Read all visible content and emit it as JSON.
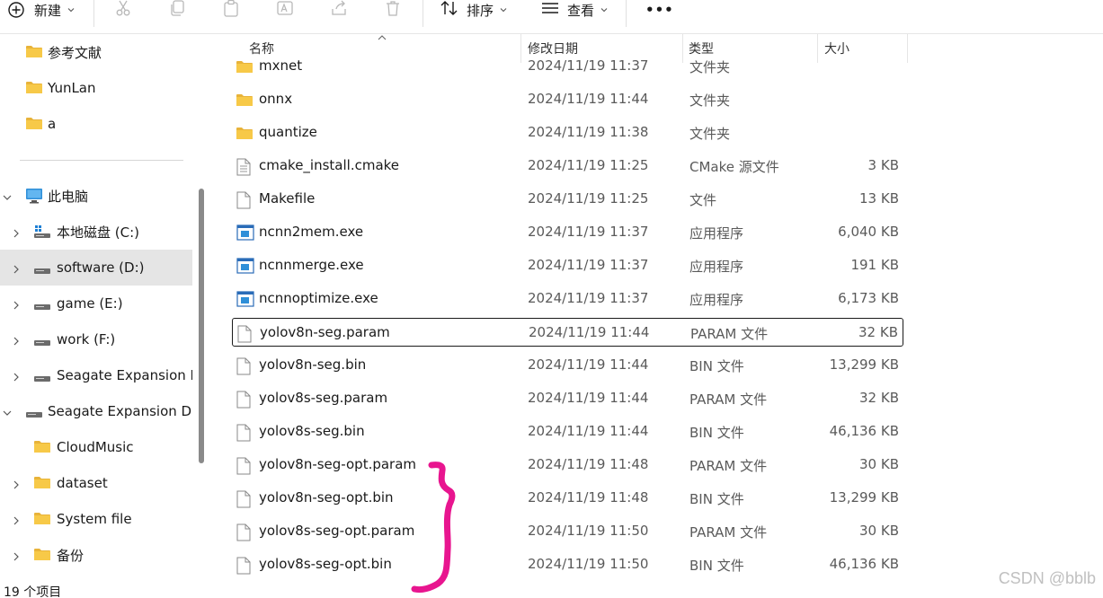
{
  "toolbar": {
    "new_label": "新建",
    "sort_label": "排序",
    "view_label": "查看",
    "more_label": "•••"
  },
  "sidebar": {
    "quick_items": [
      {
        "label": "参考文献"
      },
      {
        "label": "YunLan"
      },
      {
        "label": "a"
      }
    ],
    "this_pc": {
      "label": "此电脑"
    },
    "drives": [
      {
        "label": "本地磁盘 (C:)"
      },
      {
        "label": "software (D:)"
      },
      {
        "label": "game (E:)"
      },
      {
        "label": "work (F:)"
      },
      {
        "label": "Seagate Expansion D"
      }
    ],
    "expansion": {
      "label": "Seagate Expansion Dri"
    },
    "expansion_children": [
      {
        "label": "CloudMusic"
      },
      {
        "label": "dataset"
      },
      {
        "label": "System file"
      },
      {
        "label": "备份"
      }
    ]
  },
  "columns": {
    "name": "名称",
    "date": "修改日期",
    "type": "类型",
    "size": "大小"
  },
  "files": [
    {
      "name": "mxnet",
      "date": "2024/11/19 11:37",
      "type": "文件夹",
      "size": "",
      "icon": "folder-icon"
    },
    {
      "name": "onnx",
      "date": "2024/11/19 11:44",
      "type": "文件夹",
      "size": "",
      "icon": "folder-icon"
    },
    {
      "name": "quantize",
      "date": "2024/11/19 11:38",
      "type": "文件夹",
      "size": "",
      "icon": "folder-icon"
    },
    {
      "name": "cmake_install.cmake",
      "date": "2024/11/19 11:25",
      "type": "CMake 源文件",
      "size": "3 KB",
      "icon": "text-file-icon"
    },
    {
      "name": "Makefile",
      "date": "2024/11/19 11:25",
      "type": "文件",
      "size": "13 KB",
      "icon": "file-icon"
    },
    {
      "name": "ncnn2mem.exe",
      "date": "2024/11/19 11:37",
      "type": "应用程序",
      "size": "6,040 KB",
      "icon": "exe-icon"
    },
    {
      "name": "ncnnmerge.exe",
      "date": "2024/11/19 11:37",
      "type": "应用程序",
      "size": "191 KB",
      "icon": "exe-icon"
    },
    {
      "name": "ncnnoptimize.exe",
      "date": "2024/11/19 11:37",
      "type": "应用程序",
      "size": "6,173 KB",
      "icon": "exe-icon"
    },
    {
      "name": "yolov8n-seg.param",
      "date": "2024/11/19 11:44",
      "type": "PARAM 文件",
      "size": "32 KB",
      "icon": "file-icon"
    },
    {
      "name": "yolov8n-seg.bin",
      "date": "2024/11/19 11:44",
      "type": "BIN 文件",
      "size": "13,299 KB",
      "icon": "file-icon"
    },
    {
      "name": "yolov8s-seg.param",
      "date": "2024/11/19 11:44",
      "type": "PARAM 文件",
      "size": "32 KB",
      "icon": "file-icon"
    },
    {
      "name": "yolov8s-seg.bin",
      "date": "2024/11/19 11:44",
      "type": "BIN 文件",
      "size": "46,136 KB",
      "icon": "file-icon"
    },
    {
      "name": "yolov8n-seg-opt.param",
      "date": "2024/11/19 11:48",
      "type": "PARAM 文件",
      "size": "30 KB",
      "icon": "file-icon"
    },
    {
      "name": "yolov8n-seg-opt.bin",
      "date": "2024/11/19 11:48",
      "type": "BIN 文件",
      "size": "13,299 KB",
      "icon": "file-icon"
    },
    {
      "name": "yolov8s-seg-opt.param",
      "date": "2024/11/19 11:50",
      "type": "PARAM 文件",
      "size": "30 KB",
      "icon": "file-icon"
    },
    {
      "name": "yolov8s-seg-opt.bin",
      "date": "2024/11/19 11:50",
      "type": "BIN 文件",
      "size": "46,136 KB",
      "icon": "file-icon"
    }
  ],
  "status": {
    "count": "19 个项目"
  },
  "watermark": "CSDN @bblb",
  "colors": {
    "accent": "#0067c0",
    "selected_bg": "#e5e5e5",
    "annotation": "#e8158f"
  }
}
